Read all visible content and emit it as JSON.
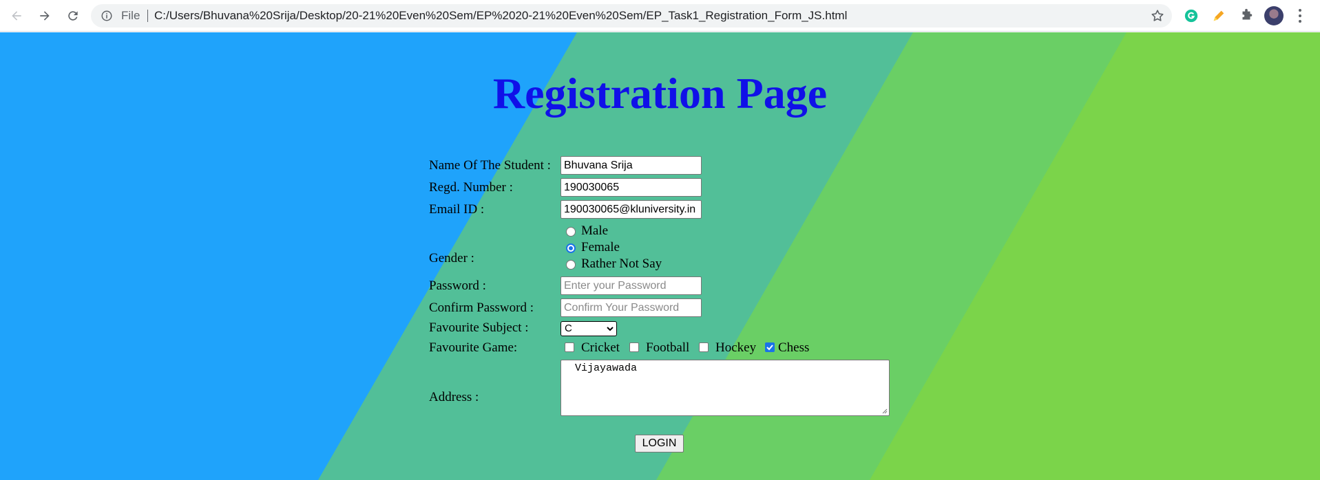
{
  "browser": {
    "file_label": "File",
    "url": "C:/Users/Bhuvana%20Srija/Desktop/20-21%20Even%20Sem/EP%2020-21%20Even%20Sem/EP_Task1_Registration_Form_JS.html"
  },
  "page": {
    "title": "Registration Page",
    "colors": {
      "title": "#1010e8",
      "bg_blue": "#1fa3fb",
      "bg_teal": "#52bf98",
      "bg_green": "#6acf65",
      "bg_lime": "#7bd44a"
    }
  },
  "form": {
    "name": {
      "label": "Name Of The Student :",
      "value": "Bhuvana Srija"
    },
    "regd": {
      "label": "Regd. Number :",
      "value": "190030065"
    },
    "email": {
      "label": "Email ID :",
      "value": "190030065@kluniversity.in"
    },
    "gender": {
      "label": "Gender :",
      "options": [
        "Male",
        "Female",
        "Rather Not Say"
      ],
      "selected": "Female"
    },
    "password": {
      "label": "Password :",
      "placeholder": "Enter your Password"
    },
    "confirm": {
      "label": "Confirm Password :",
      "placeholder": "Confirm Your Password"
    },
    "subject": {
      "label": "Favourite Subject :",
      "value": "C"
    },
    "game": {
      "label": "Favourite Game:",
      "options": [
        "Cricket",
        "Football",
        "Hockey",
        "Chess"
      ],
      "checked": [
        "Chess"
      ]
    },
    "address": {
      "label": "Address :",
      "value": "Vijayawada"
    },
    "login_label": "LOGIN"
  }
}
